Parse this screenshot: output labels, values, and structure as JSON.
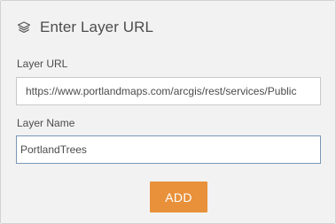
{
  "dialog": {
    "title": "Enter Layer URL",
    "title_icon": "layers-icon"
  },
  "url_field": {
    "label": "Layer URL",
    "value": "https://www.portlandmaps.com/arcgis/rest/services/Public",
    "placeholder": ""
  },
  "name_field": {
    "label": "Layer Name",
    "value": "PortlandTrees",
    "placeholder": ""
  },
  "actions": {
    "add_label": "ADD"
  },
  "colors": {
    "panel_background": "#f2f2f2",
    "accent": "#e8913a",
    "text": "#4c4c4c"
  }
}
